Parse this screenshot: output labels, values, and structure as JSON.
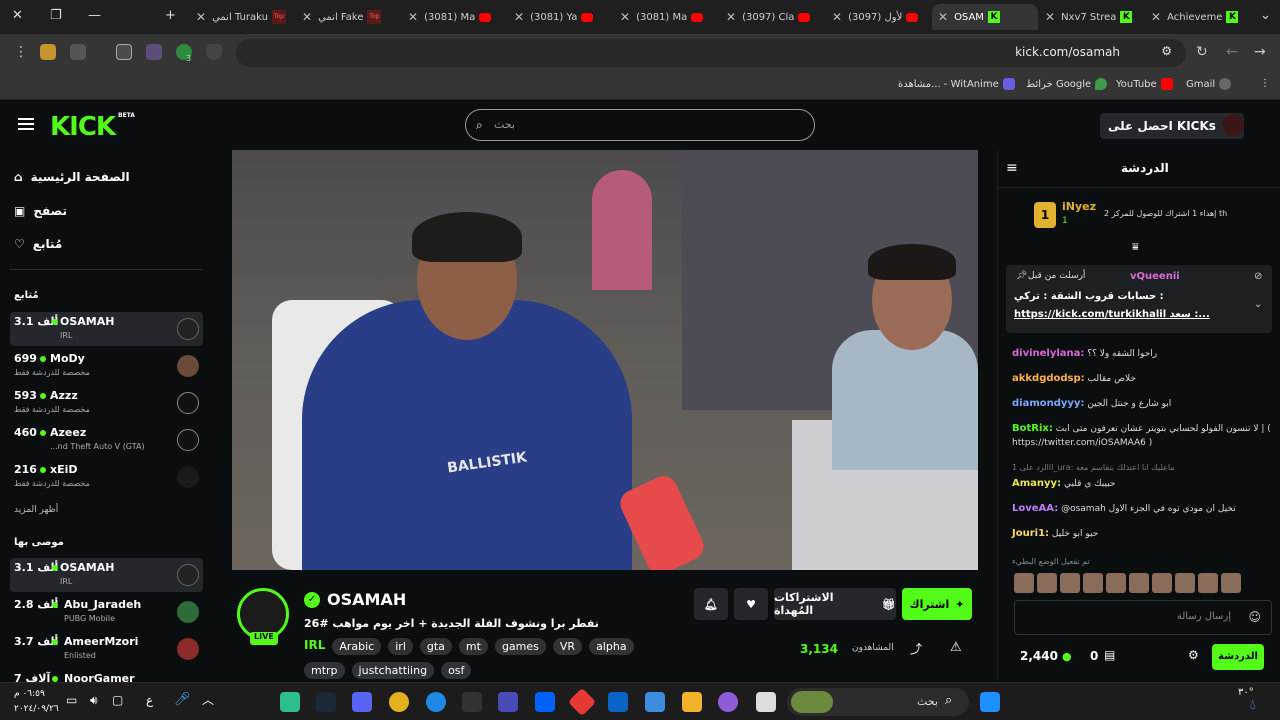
{
  "browser": {
    "tabs": [
      {
        "title": "انمي Turaku",
        "icon": "top"
      },
      {
        "title": "انمي Fake",
        "icon": "top"
      },
      {
        "title": "(3081) Ma",
        "icon": "youtube"
      },
      {
        "title": "(3081) Ya",
        "icon": "youtube"
      },
      {
        "title": "(3081) Ma",
        "icon": "youtube"
      },
      {
        "title": "(3097) Cla",
        "icon": "youtube"
      },
      {
        "title": "(3097) لأول",
        "icon": "youtube"
      },
      {
        "title": "OSAM",
        "icon": "kick",
        "active": true
      },
      {
        "title": "Nxv7 Strea",
        "icon": "kick"
      },
      {
        "title": "Achieveme",
        "icon": "kick"
      }
    ],
    "url": "kick.com/osamah",
    "bookmarks": [
      "Gmail",
      "YouTube",
      "خرائط Google",
      "مشاهدة... - WitAnime"
    ],
    "extension_badge": "3"
  },
  "kick": {
    "logo": "KICK",
    "beta": "BETA",
    "search_placeholder": "بحث",
    "get_kicks": "احصل على KICKs"
  },
  "sidebar": {
    "nav": [
      {
        "label": "الصفحة الرئيسية",
        "icon": "home-icon"
      },
      {
        "label": "تصفح",
        "icon": "browse-icon"
      },
      {
        "label": "مُتابع",
        "icon": "heart-icon"
      }
    ],
    "following_title": "مُتابع",
    "following": [
      {
        "name": "OSAMAH",
        "count": "3.1 ألف",
        "sub": "IRL",
        "selected": true
      },
      {
        "name": "MoDy",
        "count": "699",
        "sub": "مخصصة للدردشة فقط"
      },
      {
        "name": "Azzz",
        "count": "593",
        "sub": "مخصصة للدردشة فقط"
      },
      {
        "name": "Azeez",
        "count": "460",
        "sub": "...nd Theft Auto V (GTA)"
      },
      {
        "name": "xEiD",
        "count": "216",
        "sub": "مخصصة للدردشة فقط"
      }
    ],
    "show_more": "أظهر المزيد",
    "recommended_title": "موصى بها",
    "recommended": [
      {
        "name": "OSAMAH",
        "count": "3.1 ألف",
        "sub": "IRL",
        "selected": true
      },
      {
        "name": "Abu_Jaradeh",
        "count": "2.8 ألف",
        "sub": "PUBG Mobile"
      },
      {
        "name": "AmeerMzori",
        "count": "3.7 ألف",
        "sub": "Enlisted"
      },
      {
        "name": "NoorGamer",
        "count": "7 آلاف",
        "sub": ""
      }
    ]
  },
  "video": {
    "jersey_text": "BALLISTIK"
  },
  "stream": {
    "streamer": "OSAMAH",
    "live": "LIVE",
    "title": "نفطر برا ونشوف الفلة الجديدة + اخر يوم مواهب #26",
    "category": "IRL",
    "tags": [
      "Arabic",
      "irl",
      "gta",
      "mt",
      "games",
      "VR",
      "alpha",
      "mtrp",
      "justchattiing",
      "osf"
    ],
    "subscribe": "اشتراك",
    "gift_subs": "الاشتراكات المُهداة",
    "viewers": "3,134",
    "viewers_label": "المشاهدون"
  },
  "chat": {
    "title": "الدردشة",
    "gift_user": "iNyez",
    "gift_count": "1",
    "gift_rank": "2",
    "gift_text": "إهداء 1 اشتراك للوصول للمركز 2 th",
    "pinned_by": "vQueenii",
    "pinned_label": "أرسلت من قبل",
    "pinned_line1": "حسابات قروب الشقة : تركي :",
    "pinned_line2": "https://kick.com/turkikhalil سعد :...",
    "messages": [
      {
        "user": "divinelylana:",
        "text": "راحوا الشقه ولا ؟؟",
        "color": "u1"
      },
      {
        "user": "akkdgdodsp:",
        "text": "خلاص مقالب",
        "color": "u2"
      },
      {
        "user": "diamondyyy:",
        "text": "ابو شارع و جنتل الجين",
        "color": "u3"
      },
      {
        "user": "BotRix:",
        "text": "لا تنسون الفولو لحسابي بتويتر عشان تعرفون متى ابث | ( https://twitter.com/iOSAMAA6 )",
        "color": "u4"
      },
      {
        "user": "",
        "text": "الرد على 1il_ura: ماعليك انا اعتذلك بتقاسم معه",
        "color": "u5"
      },
      {
        "user": "Amanyy:",
        "text": "حبيبك ي قلبي",
        "color": "u5"
      },
      {
        "user": "LoveAA:",
        "text": "@osamah تخيل ان مودي توه في الجزء الاول",
        "color": "u6"
      },
      {
        "user": "Jouri1:",
        "text": "حيو ابو خليل",
        "color": "u7"
      }
    ],
    "emote_notice": "تم تفعيل الوضع البطيء",
    "input_placeholder": "إرسال رسالة",
    "points": "2,440",
    "kicks": "0",
    "chat_button": "الدردشة"
  },
  "taskbar": {
    "search": "بحث",
    "time": "٠٦:٥٩ م",
    "date": "٢٠٢٤/٠٩/٢٦",
    "temp": "٣٠°",
    "lang": "ع"
  },
  "colors": {
    "accent": "#53fc18",
    "bg": "#0b0e0f"
  }
}
